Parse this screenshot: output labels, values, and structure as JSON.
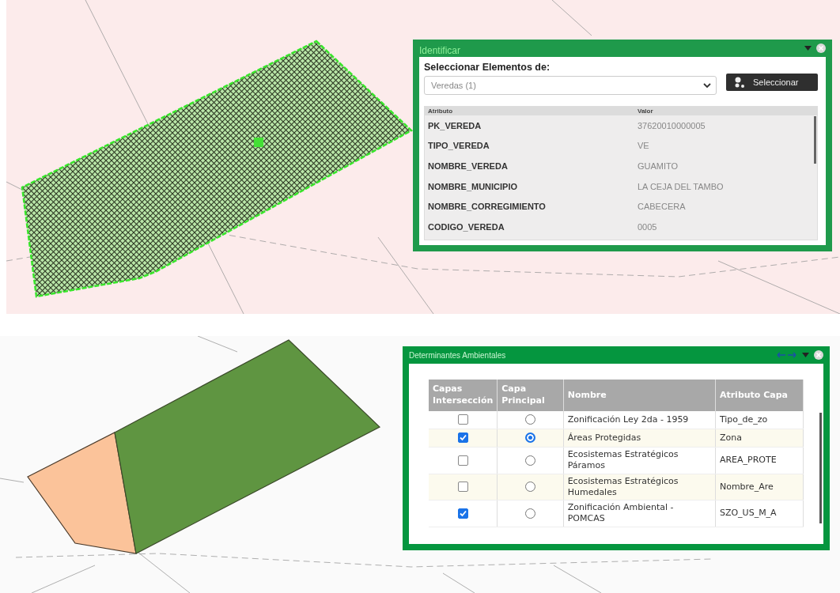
{
  "identify_panel": {
    "title": "Identificar",
    "select_label": "Seleccionar Elementos de:",
    "layer_select": {
      "value": "Veredas (1)"
    },
    "select_button": "Seleccionar",
    "columns": [
      "Atributo",
      "Valor"
    ],
    "rows": [
      {
        "attribute": "PK_VEREDA",
        "value": "37620010000005"
      },
      {
        "attribute": "TIPO_VEREDA",
        "value": "VE"
      },
      {
        "attribute": "NOMBRE_VEREDA",
        "value": "GUAMITO"
      },
      {
        "attribute": "NOMBRE_MUNICIPIO",
        "value": "LA CEJA DEL TAMBO"
      },
      {
        "attribute": "NOMBRE_CORREGIMIENTO",
        "value": "CABECERA"
      },
      {
        "attribute": "CODIGO_VEREDA",
        "value": "0005"
      }
    ]
  },
  "determinants_panel": {
    "title": "Determinantes Ambientales",
    "columns": [
      "Capas Intersección",
      "Capa Principal",
      "Nombre",
      "Atributo Capa"
    ],
    "rows": [
      {
        "intersection": false,
        "principal": false,
        "name": "Zonificación Ley 2da - 1959",
        "attribute": "Tipo_de_zo"
      },
      {
        "intersection": true,
        "principal": true,
        "name": "Áreas Protegidas",
        "attribute": "Zona"
      },
      {
        "intersection": false,
        "principal": false,
        "name": "Ecosistemas Estratégicos Páramos",
        "attribute": "AREA_PROTE"
      },
      {
        "intersection": false,
        "principal": false,
        "name": "Ecosistemas Estratégicos Humedales",
        "attribute": "Nombre_Are"
      },
      {
        "intersection": true,
        "principal": false,
        "name": "Zonificación Ambiental - POMCAS",
        "attribute": "SZO_US_M_A"
      }
    ]
  }
}
